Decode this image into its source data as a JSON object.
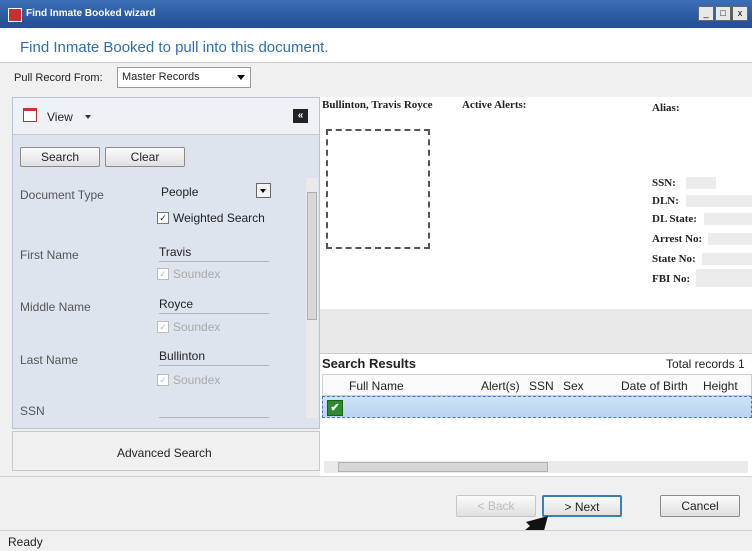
{
  "window": {
    "title": "Find Inmate Booked wizard",
    "controls": [
      "_",
      "□",
      "x"
    ]
  },
  "header": {
    "text": "Find Inmate Booked to pull into this document."
  },
  "pull": {
    "label": "Pull Record From:",
    "value": "Master Records"
  },
  "left": {
    "view_label": "View",
    "collapse_glyph": "«",
    "search_label": "Search",
    "clear_label": "Clear",
    "fields": {
      "document_type": {
        "label": "Document Type",
        "value": "People",
        "weighted": "Weighted Search"
      },
      "first_name": {
        "label": "First Name",
        "value": "Travis",
        "soundex": "Soundex"
      },
      "middle_name": {
        "label": "Middle Name",
        "value": "Royce",
        "soundex": "Soundex"
      },
      "last_name": {
        "label": "Last Name",
        "value": "Bullinton",
        "soundex": "Soundex"
      },
      "ssn": {
        "label": "SSN",
        "value": ""
      }
    },
    "advanced_search": "Advanced Search"
  },
  "detail": {
    "name": "Bullinton, Travis Royce",
    "active_alerts": "Active Alerts:",
    "alias": "Alias:",
    "ids": [
      "SSN:",
      "DLN:",
      "DL State:",
      "Arrest No:",
      "State No:",
      "FBI No:"
    ]
  },
  "results": {
    "title": "Search Results",
    "total": "Total records 1",
    "columns": [
      "Full Name",
      "Alert(s)",
      "SSN",
      "Sex",
      "Date of Birth",
      "Height"
    ],
    "row_check": "✔"
  },
  "buttons": {
    "back": "< Back",
    "next": "> Next",
    "cancel": "Cancel"
  },
  "status": "Ready"
}
